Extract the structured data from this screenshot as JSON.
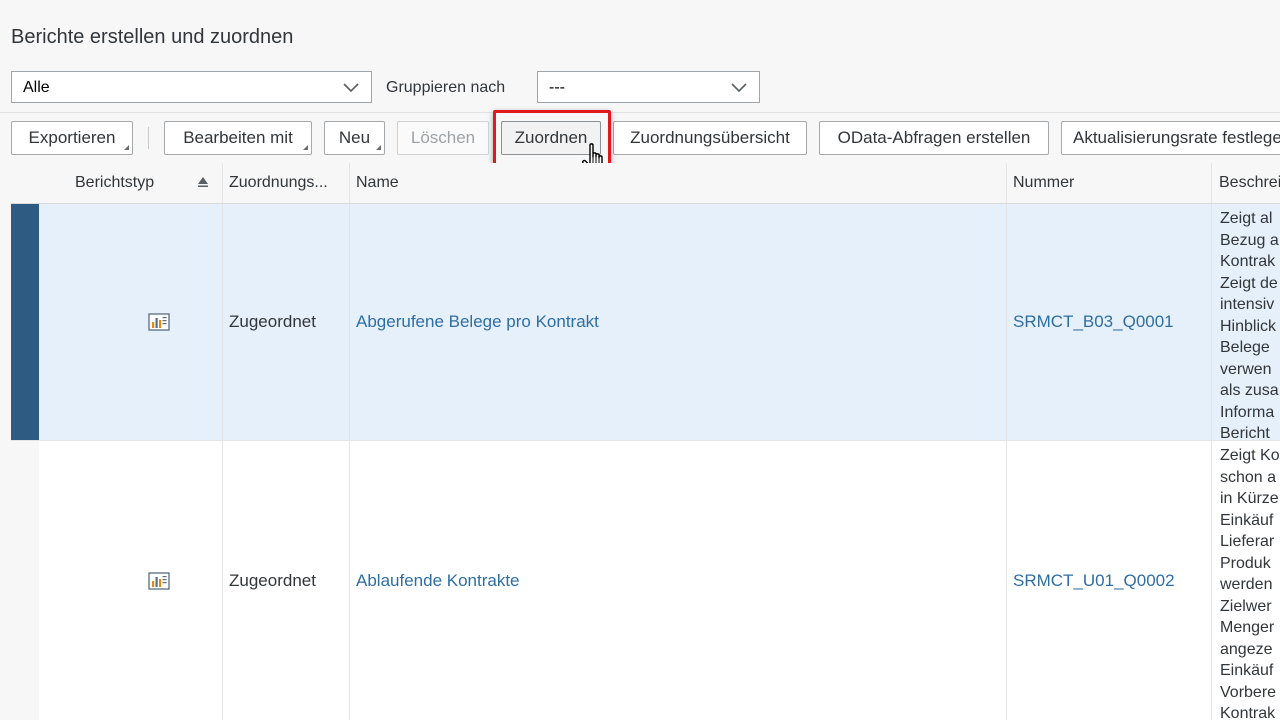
{
  "page": {
    "title": "Berichte erstellen und zuordnen"
  },
  "filters": {
    "status_value": "Alle",
    "group_label": "Gruppieren nach",
    "group_value": "---"
  },
  "toolbar": {
    "export": "Exportieren",
    "edit_with": "Bearbeiten mit",
    "new": "Neu",
    "delete": "Löschen",
    "assign": "Zuordnen",
    "assignment_overview": "Zuordnungsübersicht",
    "odata": "OData-Abfragen erstellen",
    "refresh_rate": "Aktualisierungsrate festlegen"
  },
  "table": {
    "columns": {
      "type": "Berichtstyp",
      "assignment": "Zuordnungs...",
      "name": "Name",
      "number": "Nummer",
      "description": "Beschreibung"
    },
    "rows": [
      {
        "type_icon": "report-chart-icon",
        "assignment": "Zugeordnet",
        "name": "Abgerufene Belege pro Kontrakt",
        "number": "SRMCT_B03_Q0001",
        "description_lines": [
          "Zeigt al",
          "Bezug a",
          "Kontrak",
          "Zeigt de",
          "intensiv",
          "Hinblick",
          "Belege",
          "verwen",
          "als zusa",
          "Informa",
          "Bericht"
        ]
      },
      {
        "type_icon": "report-chart-icon",
        "assignment": "Zugeordnet",
        "name": "Ablaufende Kontrakte",
        "number": "SRMCT_U01_Q0002",
        "description_lines": [
          "Zeigt Ko",
          "schon a",
          "in Kürze",
          "Einkäuf",
          "Lieferar",
          "Produk",
          "werden",
          "Zielwer",
          "Menger",
          "angeze",
          "Einkäuf",
          "Vorbere",
          "Kontrak"
        ]
      }
    ]
  },
  "colors": {
    "selection_bar": "#2e5b82",
    "selected_row": "#e5f0fa",
    "link": "#2e6ea3",
    "highlight": "#e2181f"
  }
}
